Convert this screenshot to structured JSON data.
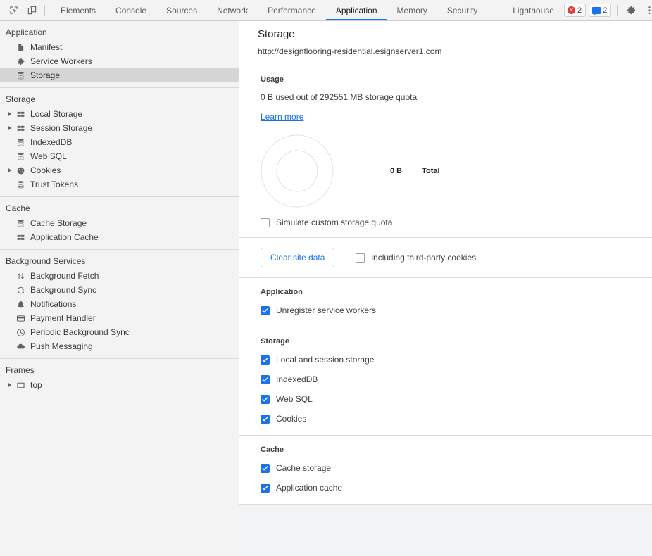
{
  "toolbar": {
    "icons": [
      {
        "name": "inspect-element-icon",
        "title": "Inspect element"
      },
      {
        "name": "device-toolbar-icon",
        "title": "Toggle device toolbar"
      }
    ],
    "tabs": [
      {
        "label": "Elements",
        "active": false
      },
      {
        "label": "Console",
        "active": false
      },
      {
        "label": "Sources",
        "active": false
      },
      {
        "label": "Network",
        "active": false
      },
      {
        "label": "Performance",
        "active": false
      },
      {
        "label": "Application",
        "active": true
      },
      {
        "label": "Memory",
        "active": false
      },
      {
        "label": "Security",
        "active": false
      },
      {
        "label": "Lighthouse",
        "active": false
      }
    ],
    "error_badge": {
      "count": "2",
      "icon": "error-icon"
    },
    "message_badge": {
      "count": "2",
      "icon": "message-icon"
    },
    "settings_icon": "gear-icon",
    "more_icon": "kebab-menu-icon",
    "close_icon": "close-icon",
    "active_tab_color": "#1a73e8"
  },
  "sidebar": {
    "groups": [
      {
        "header": "Application",
        "items": [
          {
            "label": "Manifest",
            "icon": "manifest-file-icon",
            "expandable": false,
            "selected": false
          },
          {
            "label": "Service Workers",
            "icon": "gear-icon",
            "expandable": false,
            "selected": false
          },
          {
            "label": "Storage",
            "icon": "database-icon",
            "expandable": false,
            "selected": true
          }
        ]
      },
      {
        "header": "Storage",
        "items": [
          {
            "label": "Local Storage",
            "icon": "table-icon",
            "expandable": true,
            "selected": false
          },
          {
            "label": "Session Storage",
            "icon": "table-icon",
            "expandable": true,
            "selected": false
          },
          {
            "label": "IndexedDB",
            "icon": "database-icon",
            "expandable": false,
            "selected": false
          },
          {
            "label": "Web SQL",
            "icon": "database-icon",
            "expandable": false,
            "selected": false
          },
          {
            "label": "Cookies",
            "icon": "cookie-icon",
            "expandable": true,
            "selected": false
          },
          {
            "label": "Trust Tokens",
            "icon": "database-icon",
            "expandable": false,
            "selected": false
          }
        ]
      },
      {
        "header": "Cache",
        "items": [
          {
            "label": "Cache Storage",
            "icon": "database-icon",
            "expandable": false,
            "selected": false
          },
          {
            "label": "Application Cache",
            "icon": "table-icon",
            "expandable": false,
            "selected": false
          }
        ]
      },
      {
        "header": "Background Services",
        "items": [
          {
            "label": "Background Fetch",
            "icon": "arrows-up-down-icon",
            "expandable": false,
            "selected": false
          },
          {
            "label": "Background Sync",
            "icon": "sync-icon",
            "expandable": false,
            "selected": false
          },
          {
            "label": "Notifications",
            "icon": "bell-icon",
            "expandable": false,
            "selected": false
          },
          {
            "label": "Payment Handler",
            "icon": "credit-card-icon",
            "expandable": false,
            "selected": false
          },
          {
            "label": "Periodic Background Sync",
            "icon": "clock-icon",
            "expandable": false,
            "selected": false
          },
          {
            "label": "Push Messaging",
            "icon": "cloud-icon",
            "expandable": false,
            "selected": false
          }
        ]
      },
      {
        "header": "Frames",
        "items": [
          {
            "label": "top",
            "icon": "frame-icon",
            "expandable": true,
            "selected": false
          }
        ]
      }
    ]
  },
  "main": {
    "title": "Storage",
    "url": "http://designflooring-residential.esignserver1.com",
    "usage": {
      "heading": "Usage",
      "summary": "0 B used out of 292551 MB storage quota",
      "learn_more": "Learn more",
      "simulate_label": "Simulate custom storage quota",
      "simulate_checked": false
    },
    "clear": {
      "button_label": "Clear site data",
      "third_party_label": "including third-party cookies",
      "third_party_checked": false
    },
    "sections": [
      {
        "title": "Application",
        "options": [
          {
            "label": "Unregister service workers",
            "checked": true
          }
        ]
      },
      {
        "title": "Storage",
        "options": [
          {
            "label": "Local and session storage",
            "checked": true
          },
          {
            "label": "IndexedDB",
            "checked": true
          },
          {
            "label": "Web SQL",
            "checked": true
          },
          {
            "label": "Cookies",
            "checked": true
          }
        ]
      },
      {
        "title": "Cache",
        "options": [
          {
            "label": "Cache storage",
            "checked": true
          },
          {
            "label": "Application cache",
            "checked": true
          }
        ]
      }
    ]
  },
  "chart_data": {
    "type": "pie",
    "title": "Storage usage breakdown",
    "categories": [
      "Total"
    ],
    "values": [
      0
    ],
    "value_labels": [
      "0 B"
    ],
    "legend": [
      {
        "label": "Total",
        "value": "0 B"
      }
    ],
    "total_bytes": 0,
    "quota_mb": 292551,
    "empty": true,
    "ring_color": "#e0e0e0",
    "legend_position": "right"
  }
}
